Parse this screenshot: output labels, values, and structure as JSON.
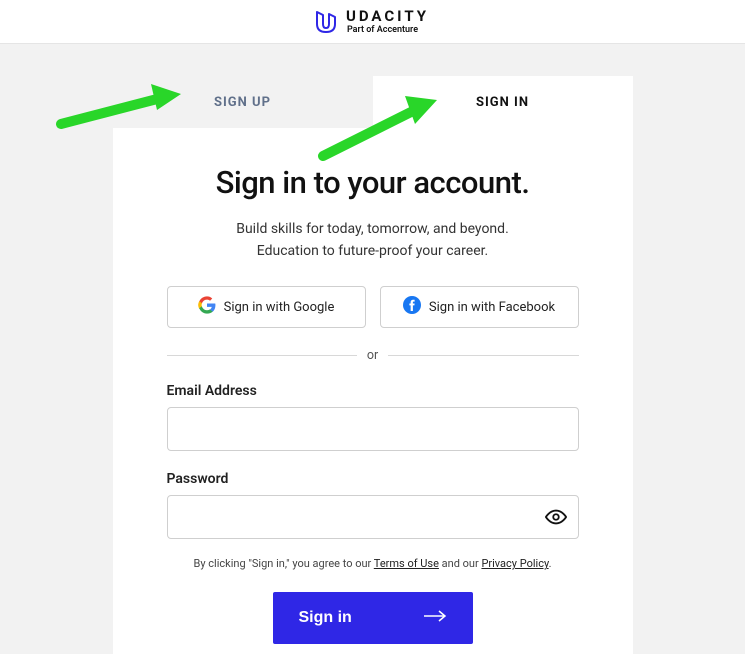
{
  "header": {
    "brand": "UDACITY",
    "tagline": "Part of Accenture"
  },
  "tabs": {
    "signup": "SIGN UP",
    "signin": "SIGN IN"
  },
  "main": {
    "heading": "Sign in to your account.",
    "sub_line1": "Build skills for today, tomorrow, and beyond.",
    "sub_line2": "Education to future-proof your career."
  },
  "social": {
    "google": "Sign in with Google",
    "facebook": "Sign in with Facebook"
  },
  "or_text": "or",
  "form": {
    "email_label": "Email Address",
    "password_label": "Password"
  },
  "terms": {
    "pre": "By clicking \"Sign in,\" you agree to our ",
    "tou": "Terms of Use",
    "mid": " and our ",
    "pp": "Privacy Policy",
    "post": "."
  },
  "submit_label": "Sign in"
}
